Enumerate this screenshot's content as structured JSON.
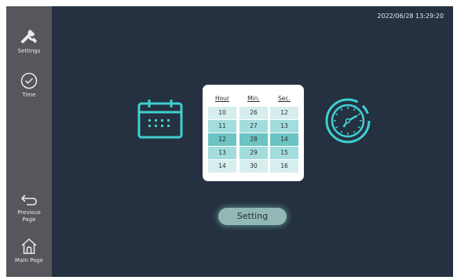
{
  "sidebar": {
    "settings_label": "Settings",
    "time_label": "Time",
    "previous_label": "Previous\nPage",
    "main_label": "Main Page"
  },
  "datetime": "2022/06/28 13:29:20",
  "picker": {
    "headers": [
      "Hour",
      "Min.",
      "Sec."
    ],
    "rows": [
      [
        "10",
        "26",
        "12"
      ],
      [
        "11",
        "27",
        "13"
      ],
      [
        "12",
        "28",
        "14"
      ],
      [
        "13",
        "29",
        "15"
      ],
      [
        "14",
        "30",
        "16"
      ]
    ]
  },
  "setting_button": "Setting",
  "colors": {
    "background": "#253140",
    "sidebar": "#56575c",
    "accent": "#3ed0d2",
    "row_light": "#d6eeee",
    "row_mid": "#a3dcdc",
    "row_selected": "#6cc3c3"
  },
  "icons": [
    "wrench-icon",
    "check-circle-icon",
    "back-arrow-icon",
    "home-icon",
    "calendar-icon",
    "wall-clock-icon"
  ]
}
